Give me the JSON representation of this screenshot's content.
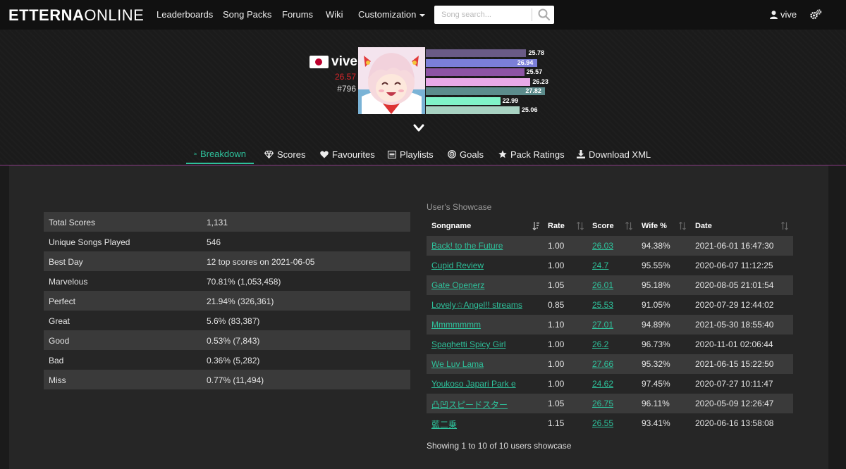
{
  "brand": {
    "bold": "ETTERNA",
    "light": "ONLINE"
  },
  "nav": {
    "links": [
      "Leaderboards",
      "Song Packs",
      "Forums",
      "Wiki",
      "Customization"
    ],
    "search_placeholder": "Song search...",
    "user": "vive"
  },
  "profile": {
    "username": "vive",
    "rating": "26.57",
    "rank": "#796",
    "country_flag": "Japan",
    "skills": [
      {
        "value": 25.78,
        "label": "25.78",
        "color": "#6a5b86"
      },
      {
        "value": 26.94,
        "label": "26.94",
        "color": "#7b7fd8"
      },
      {
        "value": 25.57,
        "label": "25.57",
        "color": "#8d54a4"
      },
      {
        "value": 26.23,
        "label": "26.23",
        "color": "#e9a9e8"
      },
      {
        "value": 27.82,
        "label": "27.82",
        "color": "#5c8c8c"
      },
      {
        "value": 22.99,
        "label": "22.99",
        "color": "#80f3c8"
      },
      {
        "value": 25.06,
        "label": "25.06",
        "color": "#a8d2c2"
      }
    ]
  },
  "tabs": [
    "Breakdown",
    "Scores",
    "Favourites",
    "Playlists",
    "Goals",
    "Pack Ratings",
    "Download XML"
  ],
  "stats": [
    {
      "label": "Total Scores",
      "value": "1,131"
    },
    {
      "label": "Unique Songs Played",
      "value": "546"
    },
    {
      "label": "Best Day",
      "value": "12 top scores on 2021-06-05"
    },
    {
      "label": "Marvelous",
      "value": "70.81%  (1,053,458)"
    },
    {
      "label": "Perfect",
      "value": "21.94%  (326,361)"
    },
    {
      "label": "Great",
      "value": "5.6%  (83,387)"
    },
    {
      "label": "Good",
      "value": "0.53%  (7,843)"
    },
    {
      "label": "Bad",
      "value": "0.36%  (5,282)"
    },
    {
      "label": "Miss",
      "value": "0.77%  (11,494)"
    }
  ],
  "showcase": {
    "title": "User's Showcase",
    "headers": [
      "Songname",
      "Rate",
      "Score",
      "Wife %",
      "Date"
    ],
    "rows": [
      {
        "song": "Back! to the Future",
        "rate": "1.00",
        "score": "26.03",
        "wife": "94.38%",
        "date": "2021-06-01 16:47:30"
      },
      {
        "song": "Cupid Review",
        "rate": "1.00",
        "score": "24.7",
        "wife": "95.55%",
        "date": "2020-06-07 11:12:25"
      },
      {
        "song": "Gate Openerz",
        "rate": "1.05",
        "score": "26.01",
        "wife": "95.18%",
        "date": "2020-08-05 21:01:54"
      },
      {
        "song": "Lovely☆Angel!! streams",
        "rate": "0.85",
        "score": "25.53",
        "wife": "91.05%",
        "date": "2020-07-29 12:44:02"
      },
      {
        "song": "Mmmmmmm",
        "rate": "1.10",
        "score": "27.01",
        "wife": "94.89%",
        "date": "2021-05-30 18:55:40"
      },
      {
        "song": "Spaghetti Spicy Girl",
        "rate": "1.00",
        "score": "26.2",
        "wife": "96.73%",
        "date": "2020-11-01 02:06:44"
      },
      {
        "song": "We Luv Lama",
        "rate": "1.00",
        "score": "27.66",
        "wife": "95.32%",
        "date": "2021-06-15 15:22:50"
      },
      {
        "song": "Youkoso Japari Park e",
        "rate": "1.00",
        "score": "24.62",
        "wife": "97.45%",
        "date": "2020-07-27 10:11:47"
      },
      {
        "song": "凸凹スピードスター",
        "rate": "1.05",
        "score": "26.75",
        "wife": "96.11%",
        "date": "2020-05-09 12:26:47"
      },
      {
        "song": "藍二乗",
        "rate": "1.15",
        "score": "26.55",
        "wife": "93.41%",
        "date": "2020-06-16 13:58:08"
      }
    ],
    "footer": "Showing 1 to 10 of 10 users showcase"
  }
}
